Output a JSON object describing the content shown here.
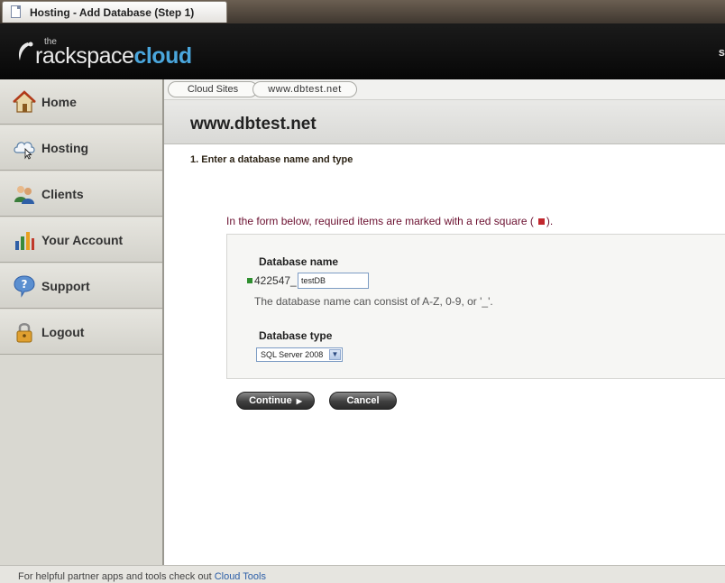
{
  "browser": {
    "tab_title": "Hosting - Add Database (Step 1)"
  },
  "header": {
    "logo_the": "the",
    "logo_rackspace": "rackspace",
    "logo_cloud": "cloud",
    "edge_text": "s"
  },
  "sidebar": {
    "items": [
      {
        "label": "Home",
        "icon": "home-icon"
      },
      {
        "label": "Hosting",
        "icon": "cloud-hosting-icon"
      },
      {
        "label": "Clients",
        "icon": "users-icon"
      },
      {
        "label": "Your Account",
        "icon": "bar-chart-icon"
      },
      {
        "label": "Support",
        "icon": "help-icon"
      },
      {
        "label": "Logout",
        "icon": "lock-icon"
      }
    ]
  },
  "breadcrumb": [
    "Cloud Sites",
    "www.dbtest.net"
  ],
  "page": {
    "title": "www.dbtest.net",
    "step": "1. Enter a database name and type",
    "required_note_before": "In the form below, required items are marked with a red square (",
    "required_note_after": ")."
  },
  "form": {
    "name_label": "Database name",
    "prefix": "422547_",
    "name_value": "testDB",
    "name_help": "The database name can consist of A-Z, 0-9, or '_'.",
    "type_label": "Database type",
    "type_value": "SQL Server 2008"
  },
  "buttons": {
    "continue": "Continue",
    "cancel": "Cancel"
  },
  "footer": {
    "text": "For helpful partner apps and tools check out ",
    "link": "Cloud Tools"
  },
  "colors": {
    "brand_blue": "#4aa6dc",
    "required_red": "#c1272d",
    "note_text": "#6b1030"
  }
}
